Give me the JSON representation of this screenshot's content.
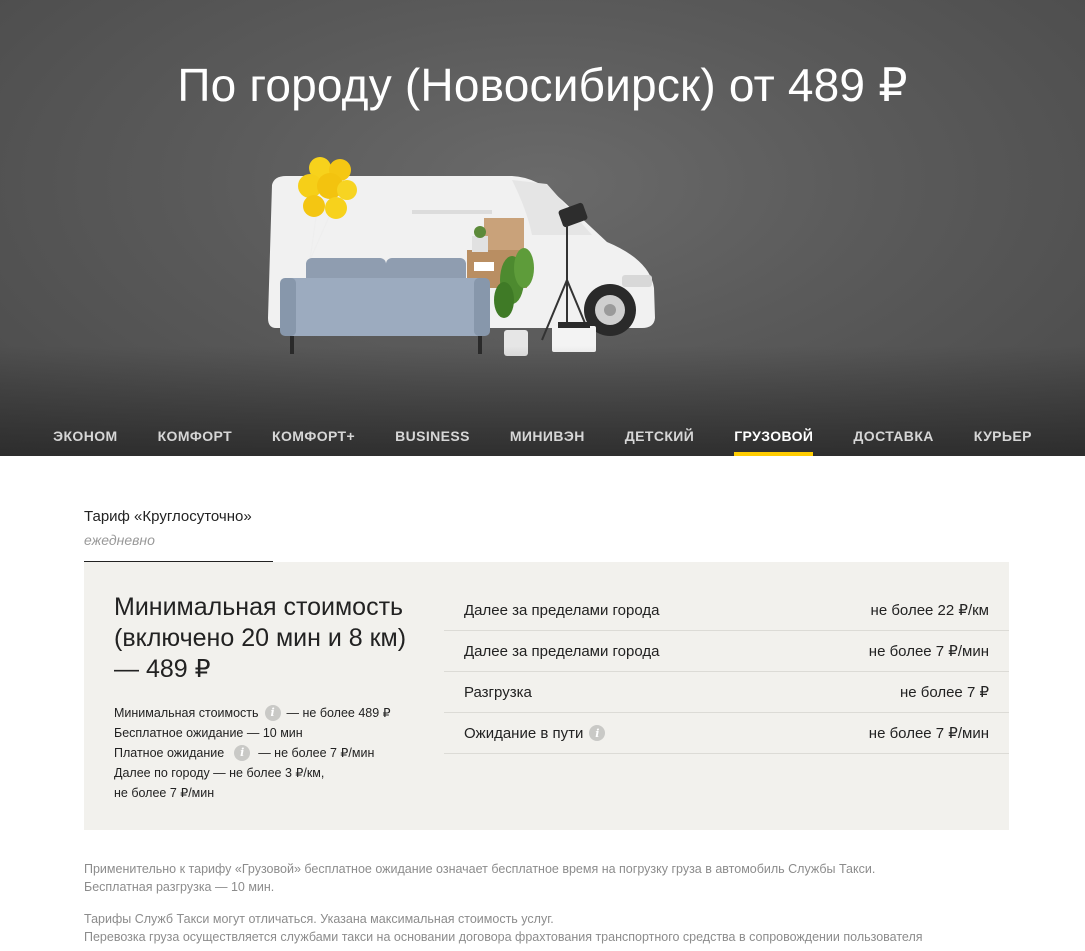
{
  "hero": {
    "title": "По городу (Новосибирск) от 489 ₽"
  },
  "tabs": [
    {
      "label": "ЭКОНОМ",
      "active": false
    },
    {
      "label": "КОМФОРТ",
      "active": false
    },
    {
      "label": "КОМФОРТ+",
      "active": false
    },
    {
      "label": "BUSINESS",
      "active": false
    },
    {
      "label": "МИНИВЭН",
      "active": false
    },
    {
      "label": "ДЕТСКИЙ",
      "active": false
    },
    {
      "label": "ГРУЗОВОЙ",
      "active": true
    },
    {
      "label": "ДОСТАВКА",
      "active": false
    },
    {
      "label": "КУРЬЕР",
      "active": false
    }
  ],
  "tariff": {
    "name": "Тариф «Круглосуточно»",
    "schedule": "ежедневно"
  },
  "panel": {
    "heading": "Минимальная стоимость (включено 20 мин и 8 км) — 489 ₽",
    "details": {
      "min_cost_label": "Минимальная стоимость",
      "min_cost_value": "— не более 489 ₽",
      "free_wait": "Бесплатное ожидание — 10 мин",
      "paid_wait_label": "Платное ожидание",
      "paid_wait_value": "— не более 7 ₽/мин",
      "city_line1": "Далее по городу — не более 3 ₽/км,",
      "city_line2": "не более 7 ₽/мин"
    },
    "rows": [
      {
        "label": "Далее за пределами города",
        "value": "не более 22 ₽/км",
        "info": false
      },
      {
        "label": "Далее за пределами города",
        "value": "не более 7 ₽/мин",
        "info": false
      },
      {
        "label": "Разгрузка",
        "value": "не более 7 ₽",
        "info": false
      },
      {
        "label": "Ожидание в пути",
        "value": "не более 7 ₽/мин",
        "info": true
      }
    ]
  },
  "notes": {
    "line1": "Применительно к тарифу «Грузовой» бесплатное ожидание означает бесплатное время на погрузку груза в автомобиль Службы Такси.",
    "line2": "Бесплатная разгрузка — 10 мин.",
    "line3": "Тарифы Служб Такси могут отличаться. Указана максимальная стоимость услуг.",
    "line4": "Перевозка груза осуществляется службами такси на основании договора фрахтования транспортного средства в сопровождении пользователя"
  },
  "icons": {
    "info": "info-icon"
  },
  "colors": {
    "accent": "#ffcc00",
    "panel_bg": "#f2f1ed",
    "hero_bg": "#5a5a5a"
  }
}
